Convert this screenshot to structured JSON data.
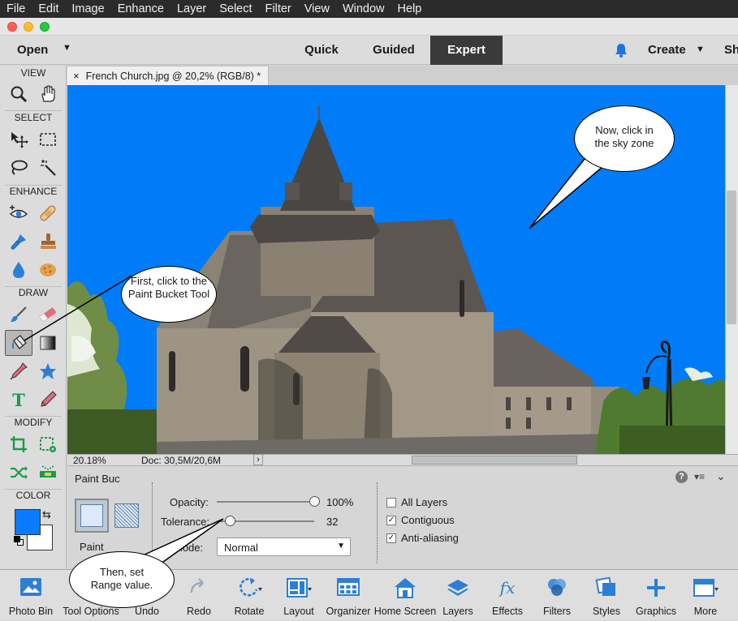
{
  "menu": [
    "File",
    "Edit",
    "Image",
    "Enhance",
    "Layer",
    "Select",
    "Filter",
    "View",
    "Window",
    "Help"
  ],
  "header": {
    "open_label": "Open",
    "modes": [
      "Quick",
      "Guided",
      "Expert"
    ],
    "active_mode": "Expert",
    "create_label": "Create",
    "share_label": "Sh"
  },
  "toolbox": {
    "sections": [
      "VIEW",
      "SELECT",
      "ENHANCE",
      "DRAW",
      "MODIFY",
      "COLOR"
    ]
  },
  "document": {
    "tab_title": "French Church.jpg @ 20,2% (RGB/8) *",
    "close_glyph": "×"
  },
  "status": {
    "zoom": "20.18%",
    "doc_info": "Doc: 30,5M/20,6M",
    "arrow": "›"
  },
  "options": {
    "tool_name": "Paint Buc",
    "paint_label": "Paint",
    "opacity_label": "Opacity:",
    "opacity_value": "100%",
    "opacity_level": 1.0,
    "tolerance_label": "Tolerance:",
    "tolerance_value": "32",
    "tolerance_level": 0.13,
    "mode_label": "Mode:",
    "mode_value": "Normal",
    "all_layers_label": "All Layers",
    "contiguous_label": "Contiguous",
    "anti_aliasing_label": "Anti-aliasing",
    "all_layers": false,
    "contiguous": true,
    "anti_aliasing": true
  },
  "annotations": {
    "bubble1": [
      "First, click to the",
      "Paint Bucket Tool"
    ],
    "bubble2": [
      "Now, click in",
      "the sky zone"
    ],
    "bubble3": [
      "Then, set",
      "Range value."
    ]
  },
  "bottom_bar": [
    {
      "label": "Photo Bin",
      "icon": "photo-bin-icon"
    },
    {
      "label": "Tool Options",
      "icon": "tool-options-icon"
    },
    {
      "label": "Undo",
      "icon": "undo-icon"
    },
    {
      "label": "Redo",
      "icon": "redo-icon"
    },
    {
      "label": "Rotate",
      "icon": "rotate-icon"
    },
    {
      "label": "Layout",
      "icon": "layout-icon"
    },
    {
      "label": "Organizer",
      "icon": "organizer-icon"
    },
    {
      "label": "Home Screen",
      "icon": "home-icon"
    },
    {
      "label": "Layers",
      "icon": "layers-icon"
    },
    {
      "label": "Effects",
      "icon": "effects-icon"
    },
    {
      "label": "Filters",
      "icon": "filters-icon"
    },
    {
      "label": "Styles",
      "icon": "styles-icon"
    },
    {
      "label": "Graphics",
      "icon": "graphics-icon"
    },
    {
      "label": "More",
      "icon": "more-icon"
    }
  ],
  "colors": {
    "sky": "#007cf8",
    "foreground_swatch": "#0a7bff",
    "background_swatch": "#ffffff",
    "icon_blue": "#2d7fd6"
  }
}
